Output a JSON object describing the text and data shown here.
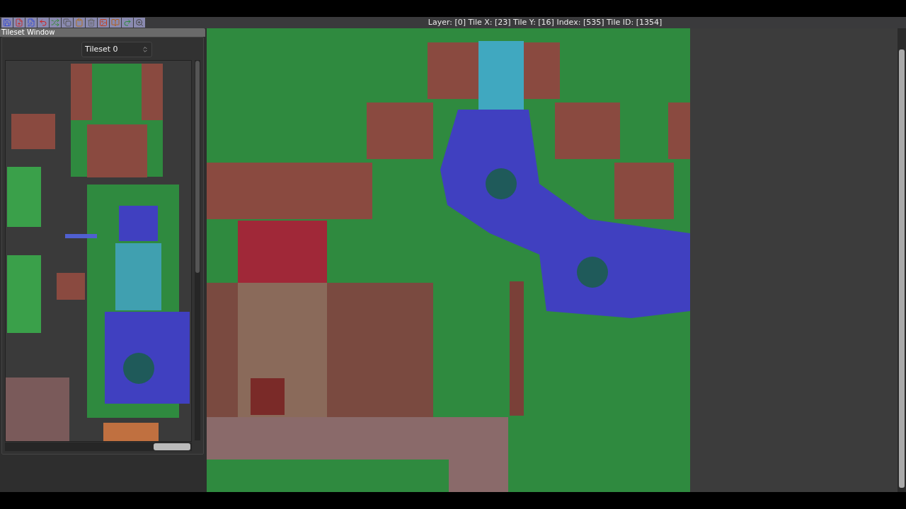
{
  "status_bar": {
    "text": "Layer: [0] Tile X: [23] Tile Y: [16] Index: [535] Tile ID: [1354]"
  },
  "tileset_window": {
    "title": "Tileset Window",
    "tileset_select": {
      "value": "Tileset 0"
    }
  }
}
